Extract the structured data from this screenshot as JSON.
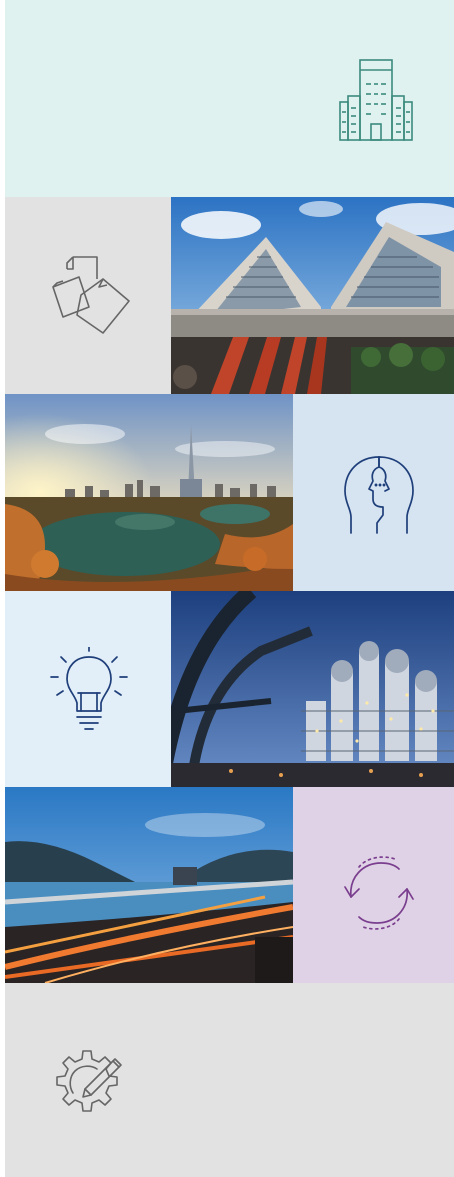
{
  "colors": {
    "mint_bg": "#e0f2ef",
    "teal_icon": "#3b8a7d",
    "grey_bg": "#e2e2e2",
    "grey_icon": "#666666",
    "light_blue_bg": "#d6e4f2",
    "navy_icon": "#1f3f7a",
    "pale_blue_bg": "#e2eef8",
    "lilac_bg": "#e0d2e6",
    "purple_icon": "#7a3e8e"
  },
  "tiles": [
    {
      "name": "building",
      "icon": "office-building-icon"
    },
    {
      "name": "documents",
      "icon": "documents-icon"
    },
    {
      "name": "apartments-photo",
      "icon": "photo"
    },
    {
      "name": "lake-city-photo",
      "icon": "photo"
    },
    {
      "name": "mind",
      "icon": "head-profile-icon"
    },
    {
      "name": "idea",
      "icon": "lightbulb-icon"
    },
    {
      "name": "industrial-plant-photo",
      "icon": "photo"
    },
    {
      "name": "bridge-photo",
      "icon": "photo"
    },
    {
      "name": "cycle",
      "icon": "refresh-cycle-icon"
    },
    {
      "name": "engineering",
      "icon": "gear-pencil-icon"
    }
  ]
}
